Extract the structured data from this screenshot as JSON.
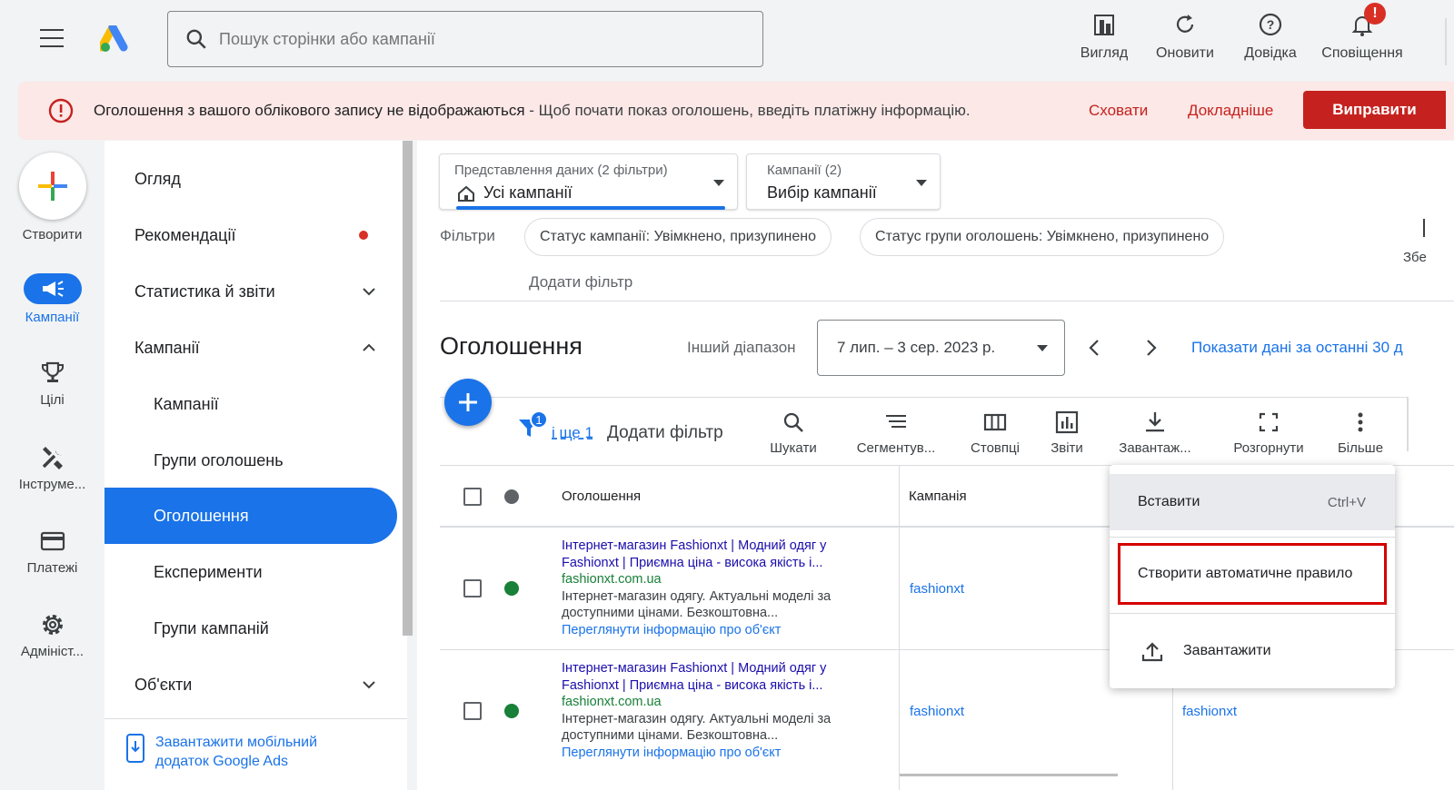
{
  "header": {
    "search_placeholder": "Пошук сторінки або кампанії",
    "buttons": [
      {
        "label": "Вигляд",
        "icon": "view-icon"
      },
      {
        "label": "Оновити",
        "icon": "refresh-icon"
      },
      {
        "label": "Довідка",
        "icon": "help-icon"
      },
      {
        "label": "Сповіщення",
        "icon": "bell-icon",
        "badge": "!"
      }
    ]
  },
  "banner": {
    "title": "Оголошення з вашого облікового запису не відображаються",
    "subtitle": " - Щоб почати показ оголошень, введіть платіжну інформацію.",
    "hide": "Сховати",
    "more": "Докладніше",
    "fix": "Виправити"
  },
  "rail": {
    "create": "Створити",
    "campaigns": "Кампанії",
    "goals": "Цілі",
    "tools": "Інструме...",
    "billing": "Платежі",
    "admin": "Адмініст..."
  },
  "nav": {
    "items": [
      {
        "label": "Огляд"
      },
      {
        "label": "Рекомендації"
      },
      {
        "label": "Статистика й звіти"
      },
      {
        "label": "Кампанії"
      },
      {
        "label": "Кампанії"
      },
      {
        "label": "Групи оголошень"
      },
      {
        "label": "Оголошення"
      },
      {
        "label": "Експерименти"
      },
      {
        "label": "Групи кампаній"
      },
      {
        "label": "Об'єкти"
      }
    ],
    "mobile_app": "Завантажити мобільний додаток Google Ads"
  },
  "filters": {
    "view_small": "Представлення даних (2 фільтри)",
    "view_big": "Усі кампанії",
    "campaign_small": "Кампанії (2)",
    "campaign_big": "Вибір кампанії",
    "label": "Фільтри",
    "chip1": "Статус кампанії: Увімкнено, призупинено",
    "chip2": "Статус групи оголошень: Увімкнено, призупинено",
    "add": "Додати фільтр",
    "cut_text": "Збе"
  },
  "page": {
    "title": "Оголошення",
    "range_label": "Інший діапазон",
    "range_value": "7 лип. – 3 сер. 2023 р.",
    "last30": "Показати дані за останні 30 д"
  },
  "toolbar": {
    "filter_badge": "1",
    "more_filters": "і ще 1",
    "add_filter": "Додати фільтр",
    "tools": [
      {
        "label": "Шукати",
        "icon": "search-icon"
      },
      {
        "label": "Сегментув...",
        "icon": "segment-icon"
      },
      {
        "label": "Стовпці",
        "icon": "columns-icon"
      },
      {
        "label": "Звіти",
        "icon": "reports-icon"
      },
      {
        "label": "Завантаж...",
        "icon": "download-icon"
      },
      {
        "label": "Розгорнути",
        "icon": "expand-icon"
      },
      {
        "label": "Більше",
        "icon": "more-vert-icon"
      }
    ]
  },
  "table": {
    "headers": [
      "Оголошення",
      "Кампанія"
    ],
    "rows": [
      {
        "title": "Інтернет-магазин Fashionxt | Модний одяг у Fashionxt | Приємна ціна - висока якість  і...",
        "url": "fashionxt.com.ua",
        "desc": "Інтернет-магазин одягу. Актуальні моделі за доступними цінами. Безкоштовна...",
        "link": "Переглянути інформацію про об'єкт",
        "campaign": "fashionxt"
      },
      {
        "title": "Інтернет-магазин Fashionxt | Модний одяг у Fashionxt | Приємна ціна - висока якість  і...",
        "url": "fashionxt.com.ua",
        "desc": "Інтернет-магазин одягу. Актуальні моделі за доступними цінами. Безкоштовна...",
        "link": "Переглянути інформацію про об'єкт",
        "campaign": "fashionxt",
        "extra": "fashionxt"
      }
    ]
  },
  "menu": {
    "paste": "Вставити",
    "paste_shortcut": "Ctrl+V",
    "create_rule": "Створити автоматичне правило",
    "upload": "Завантажити"
  },
  "colors": {
    "accent": "#1a73e8",
    "error": "#c5221f",
    "enabled": "#188038",
    "highlight_border": "#d50000"
  }
}
